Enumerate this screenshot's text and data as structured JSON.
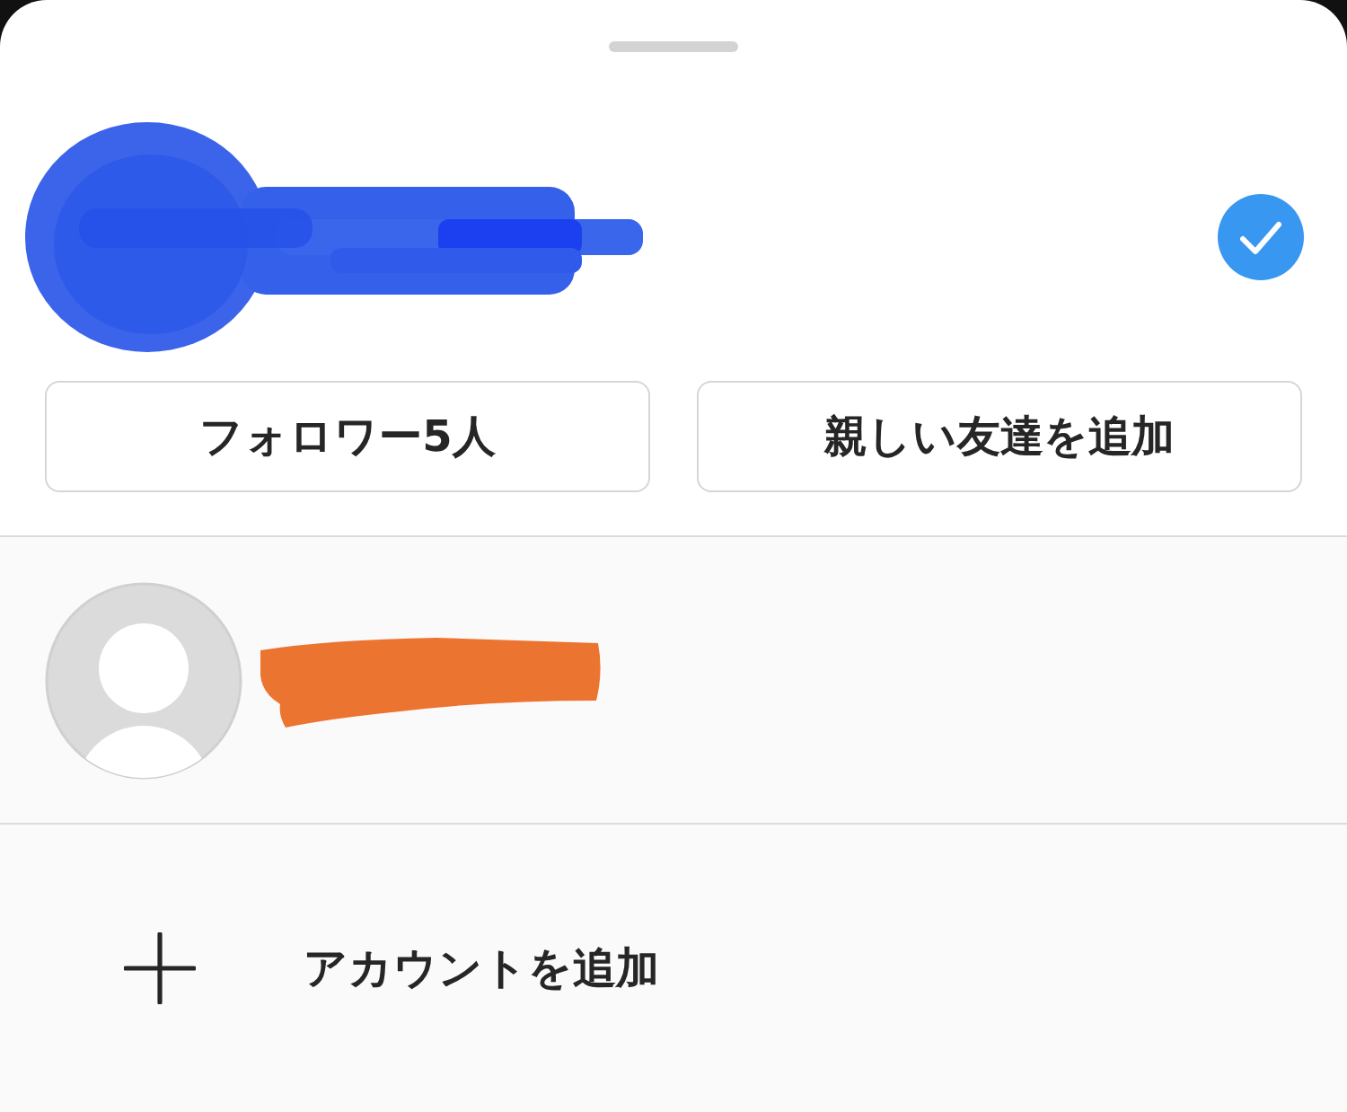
{
  "accounts": [
    {
      "kind": "current",
      "selected": true,
      "buttons": [
        {
          "label": "フォロワー5人"
        },
        {
          "label": "親しい友達を追加"
        }
      ]
    },
    {
      "kind": "other",
      "selected": false
    }
  ],
  "add_account": {
    "label": "アカウントを追加"
  }
}
